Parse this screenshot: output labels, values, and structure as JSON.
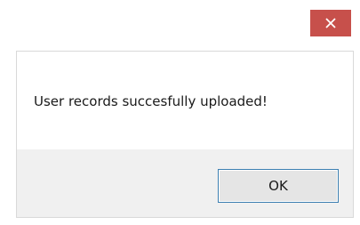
{
  "titlebar": {
    "close_icon": "close-icon",
    "close_color": "#c7504b"
  },
  "dialog": {
    "message": "User records succesfully uploaded!",
    "ok_label": "OK"
  }
}
